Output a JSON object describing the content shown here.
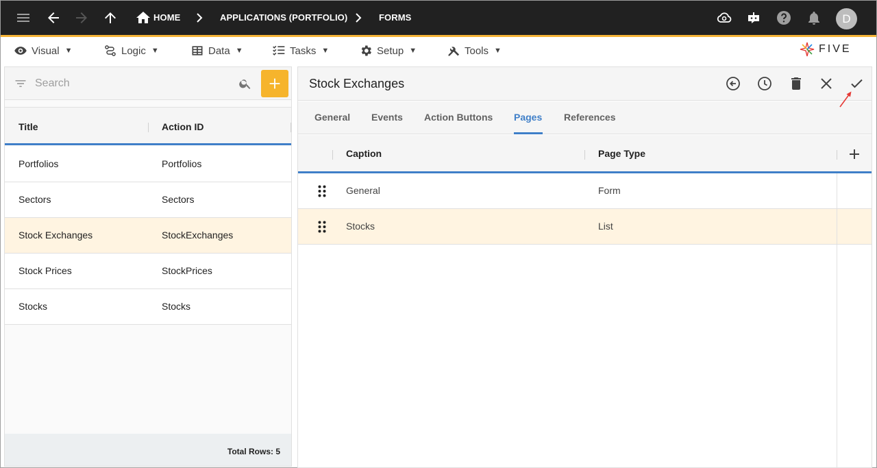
{
  "breadcrumbs": {
    "home": "HOME",
    "app": "APPLICATIONS (PORTFOLIO)",
    "current": "FORMS"
  },
  "user": {
    "avatar_initial": "D"
  },
  "menu": [
    {
      "label": "Visual",
      "icon": "eye-icon"
    },
    {
      "label": "Logic",
      "icon": "logic-icon"
    },
    {
      "label": "Data",
      "icon": "table-icon"
    },
    {
      "label": "Tasks",
      "icon": "tasks-icon"
    },
    {
      "label": "Setup",
      "icon": "gear-icon"
    },
    {
      "label": "Tools",
      "icon": "tools-icon"
    }
  ],
  "menu_caret": "▼",
  "logo": {
    "text": "FIVE"
  },
  "left": {
    "search_placeholder": "Search",
    "columns": [
      "Title",
      "Action ID"
    ],
    "rows": [
      {
        "title": "Portfolios",
        "action_id": "Portfolios"
      },
      {
        "title": "Sectors",
        "action_id": "Sectors"
      },
      {
        "title": "Stock Exchanges",
        "action_id": "StockExchanges"
      },
      {
        "title": "Stock Prices",
        "action_id": "StockPrices"
      },
      {
        "title": "Stocks",
        "action_id": "Stocks"
      }
    ],
    "selected_index": 2,
    "total_rows": "Total Rows: 5"
  },
  "form": {
    "title": "Stock Exchanges",
    "tabs": [
      "General",
      "Events",
      "Action Buttons",
      "Pages",
      "References"
    ],
    "active_tab": "Pages",
    "grid": {
      "columns": [
        "Caption",
        "Page Type"
      ],
      "rows": [
        {
          "caption": "General",
          "page_type": "Form"
        },
        {
          "caption": "Stocks",
          "page_type": "List"
        }
      ],
      "selected_index": 1
    }
  },
  "colors": {
    "topbar": "#212121",
    "accent_yellow": "#f6b42c",
    "active_blue": "#3f7fc8",
    "selected_row": "#fff4e1",
    "annotation_red": "#e53935"
  }
}
